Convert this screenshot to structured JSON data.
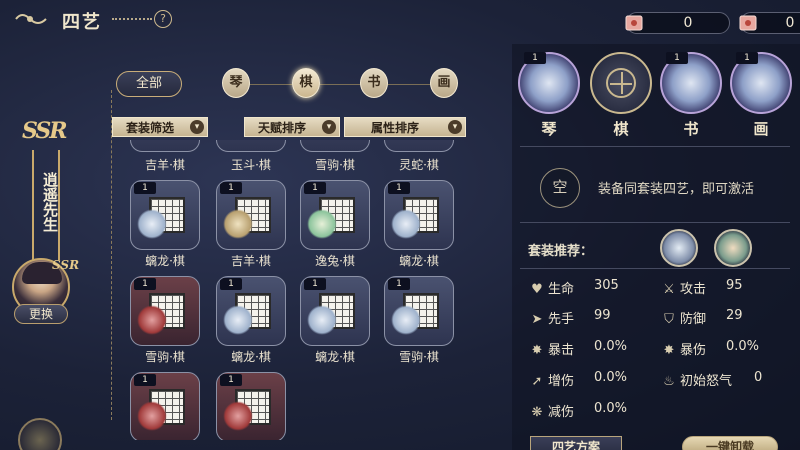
{
  "header": {
    "title": "四艺",
    "help": "?",
    "currencies": [
      {
        "icon": "ticket-icon",
        "value": "0"
      },
      {
        "icon": "ticket-icon",
        "value": "0"
      }
    ]
  },
  "character": {
    "rarity": "SSR",
    "name": "逍遥先生",
    "change_label": "更换"
  },
  "filters": {
    "all_label": "全部",
    "categories": [
      "琴",
      "棋",
      "书",
      "画"
    ],
    "active_category": "棋",
    "dropdowns": [
      "套装筛选",
      "天赋排序",
      "属性排序"
    ]
  },
  "items": [
    {
      "level": "",
      "name": "吉羊·棋"
    },
    {
      "level": "",
      "name": "玉斗·棋"
    },
    {
      "level": "",
      "name": "雪驹·棋"
    },
    {
      "level": "",
      "name": "灵蛇·棋"
    },
    {
      "level": "1",
      "name": "螭龙·棋"
    },
    {
      "level": "1",
      "name": "吉羊·棋"
    },
    {
      "level": "1",
      "name": "逸兔·棋"
    },
    {
      "level": "1",
      "name": "螭龙·棋"
    },
    {
      "level": "1",
      "name": "雪驹·棋"
    },
    {
      "level": "1",
      "name": "螭龙·棋"
    },
    {
      "level": "1",
      "name": "螭龙·棋"
    },
    {
      "level": "1",
      "name": "雪驹·棋"
    },
    {
      "level": "1",
      "name": ""
    },
    {
      "level": "1",
      "name": ""
    }
  ],
  "equipped": {
    "slots": [
      {
        "label": "琴",
        "level": "1",
        "filled": true
      },
      {
        "label": "棋",
        "level": "",
        "filled": false
      },
      {
        "label": "书",
        "level": "1",
        "filled": true
      },
      {
        "label": "画",
        "level": "1",
        "filled": true
      }
    ],
    "empty_mark": "空",
    "set_hint": "装备同套装四艺，即可激活",
    "recommend_label": "套装推荐："
  },
  "stats": [
    {
      "icon": "heart-icon",
      "name": "生命",
      "value": "305"
    },
    {
      "icon": "sword-icon",
      "name": "攻击",
      "value": "95"
    },
    {
      "icon": "arrow-icon",
      "name": "先手",
      "value": "99"
    },
    {
      "icon": "shield-icon",
      "name": "防御",
      "value": "29"
    },
    {
      "icon": "burst-icon",
      "name": "暴击",
      "value": "0.0%"
    },
    {
      "icon": "burst-icon",
      "name": "暴伤",
      "value": "0.0%"
    },
    {
      "icon": "boost-icon",
      "name": "增伤",
      "value": "0.0%"
    },
    {
      "icon": "fire-icon",
      "name": "初始怒气",
      "value": "0"
    },
    {
      "icon": "reduce-icon",
      "name": "减伤",
      "value": "0.0%"
    }
  ],
  "actions": {
    "plan_label": "四艺方案",
    "unequip_label": "一键卸载"
  }
}
